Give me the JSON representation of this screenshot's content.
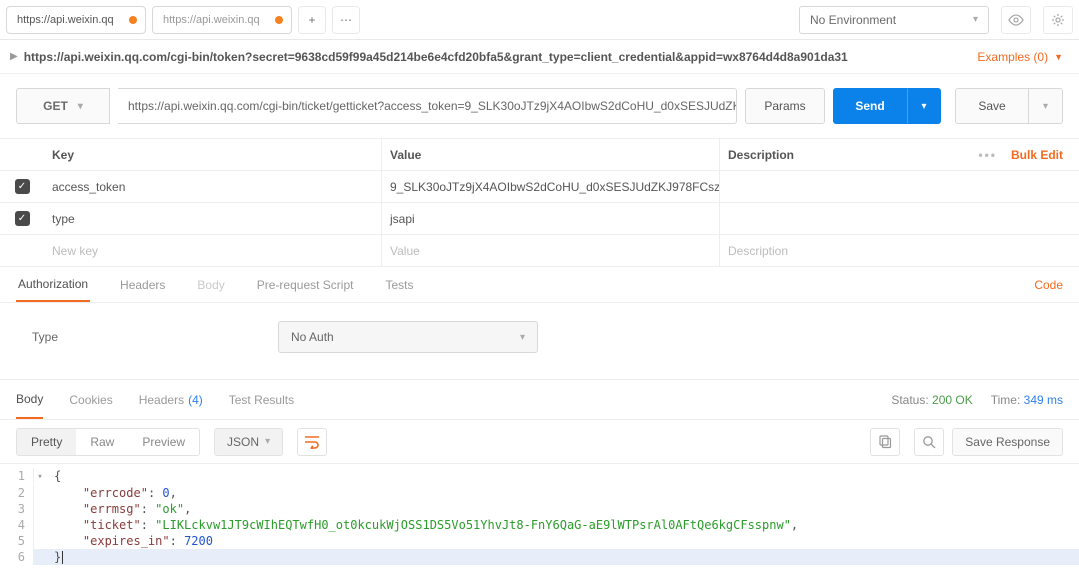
{
  "env": {
    "label": "No Environment"
  },
  "tabs": [
    {
      "title": "https://api.weixin.qq",
      "modified": true,
      "active": true
    },
    {
      "title": "https://api.weixin.qq",
      "modified": true,
      "active": false
    }
  ],
  "urlline": "https://api.weixin.qq.com/cgi-bin/token?secret=9638cd59f99a45d214be6e4cfd20bfa5&grant_type=client_credential&appid=wx8764d4d8a901da31",
  "examples_label": "Examples (0)",
  "request": {
    "method": "GET",
    "url": "https://api.weixin.qq.com/cgi-bin/ticket/getticket?access_token=9_SLK30oJTz9jX4AOIbwS2dCoHU_d0xSESJUdZKJ...",
    "params_btn": "Params",
    "send_btn": "Send",
    "save_btn": "Save"
  },
  "params": {
    "headers": {
      "key": "Key",
      "value": "Value",
      "description": "Description"
    },
    "bulk_edit": "Bulk Edit",
    "rows": [
      {
        "enabled": true,
        "key": "access_token",
        "value": "9_SLK30oJTz9jX4AOIbwS2dCoHU_d0xSESJUdZKJ978FCsz...",
        "description": ""
      },
      {
        "enabled": true,
        "key": "type",
        "value": "jsapi",
        "description": ""
      }
    ],
    "placeholder": {
      "key": "New key",
      "value": "Value",
      "description": "Description"
    }
  },
  "subtabs": {
    "items": [
      "Authorization",
      "Headers",
      "Body",
      "Pre-request Script",
      "Tests"
    ],
    "active": "Authorization",
    "code_link": "Code"
  },
  "auth": {
    "type_label": "Type",
    "selected": "No Auth"
  },
  "response_tabs": {
    "items": [
      {
        "label": "Body",
        "count": null
      },
      {
        "label": "Cookies",
        "count": null
      },
      {
        "label": "Headers",
        "count": "(4)"
      },
      {
        "label": "Test Results",
        "count": null
      }
    ],
    "active": "Body",
    "status_label": "Status:",
    "status_value": "200 OK",
    "time_label": "Time:",
    "time_value": "349 ms"
  },
  "bodybar": {
    "views": [
      "Pretty",
      "Raw",
      "Preview"
    ],
    "active_view": "Pretty",
    "format": "JSON",
    "save_response": "Save Response"
  },
  "response_body": {
    "errcode": 0,
    "errmsg": "ok",
    "ticket": "LIKLckvw1JT9cWIhEQTwfH0_ot0kcukWjOSS1DS5Vo51YhvJt8-FnY6QaG-aE9lWTPsrAl0AFtQe6kgCFsspnw",
    "expires_in": 7200
  }
}
